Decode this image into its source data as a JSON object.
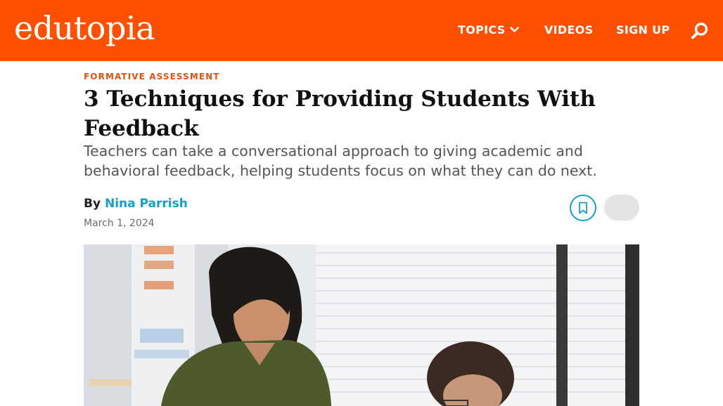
{
  "header": {
    "logo": "edutopia",
    "nav": [
      {
        "label": "TOPICS"
      },
      {
        "label": "VIDEOS"
      },
      {
        "label": "SIGN UP"
      }
    ],
    "brand_color": "#ff5000"
  },
  "article": {
    "kicker": "FORMATIVE ASSESSMENT",
    "title": "3 Techniques for Providing Students With Feedback",
    "subtitle": "Teachers can take a conversational approach to giving academic and behavioral feedback, helping students focus on what they can do next.",
    "byline_prefix": "By",
    "author": "Nina Parrish",
    "date": "March 1, 2024"
  },
  "icons": {
    "search": "search-icon",
    "chevron": "chevron-down-icon",
    "bookmark": "bookmark-icon"
  },
  "colors": {
    "kicker": "#e8520f",
    "author_link": "#13a1c7"
  }
}
